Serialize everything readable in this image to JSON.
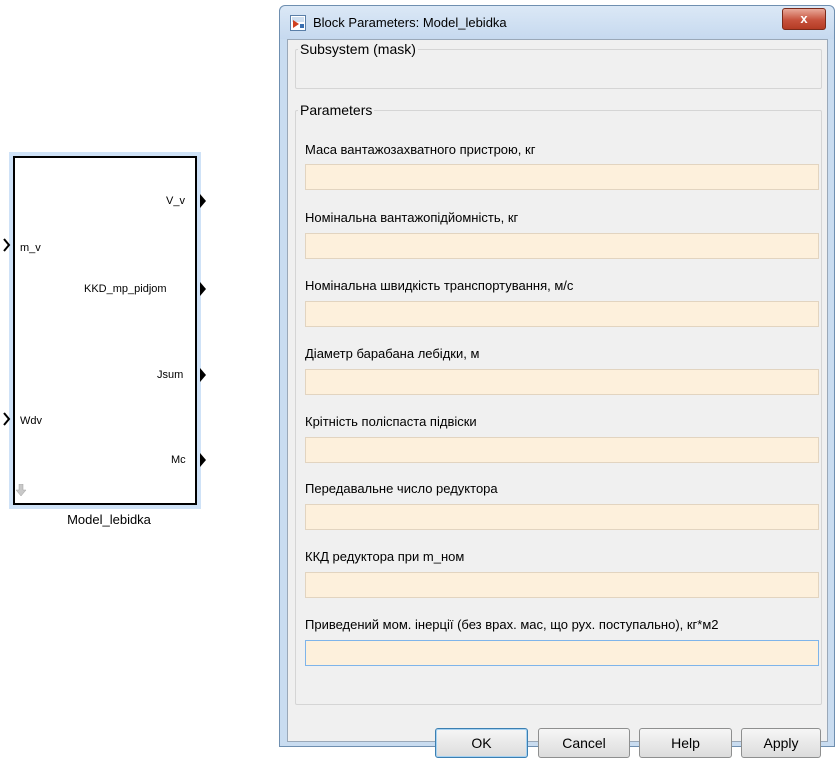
{
  "block": {
    "name": "Model_lebidka",
    "inputs": [
      "m_v",
      "Wdv"
    ],
    "outputs": [
      "V_v",
      "KKD_mp_pidjom",
      "Jsum",
      "Mc"
    ]
  },
  "dialog": {
    "title": "Block Parameters: Model_lebidka",
    "close_label": "x",
    "subsystem_legend": "Subsystem (mask)",
    "parameters_legend": "Parameters",
    "params": [
      {
        "label": "Маса вантажозахватного пристрою, кг",
        "value": ""
      },
      {
        "label": "Номінальна вантажопідйомність, кг",
        "value": ""
      },
      {
        "label": "Номінальна швидкість транспортування, м/с",
        "value": ""
      },
      {
        "label": "Діаметр барабана лебідки, м",
        "value": ""
      },
      {
        "label": "Крітність поліспаста підвіски",
        "value": ""
      },
      {
        "label": "Передавальне число редуктора",
        "value": ""
      },
      {
        "label": "ККД редуктора при m_ном",
        "value": ""
      },
      {
        "label": "Приведений мом. інерції (без врах. мас, що рух. поступально), кг*м2",
        "value": ""
      }
    ],
    "buttons": {
      "ok": "OK",
      "cancel": "Cancel",
      "help": "Help",
      "apply": "Apply"
    }
  },
  "colors": {
    "input_bg": "#fdf0dc",
    "focus_border": "#7eb4ea",
    "close_red": "#c7523d",
    "selection_blue": "#cfe2f7"
  },
  "icons": {
    "title": "simulink-block-icon",
    "close": "close-icon",
    "rotate": "down-arrow-icon"
  }
}
